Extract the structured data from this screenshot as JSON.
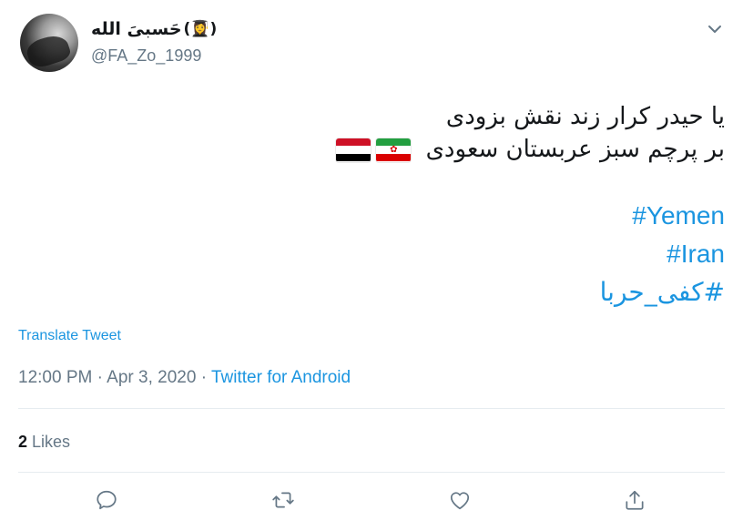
{
  "user": {
    "display_name": "حَسبیَ الله",
    "name_emoji": "(👩‍🎓)",
    "handle": "@FA_Zo_1999"
  },
  "tweet": {
    "line1": "یا حیدر کرار زند نقش بزودی",
    "line2": "بر پرچم سبز عربستان سعودی",
    "hashtags": [
      "#Yemen",
      "#Iran",
      "#کفی_حربا"
    ],
    "flag_colors": {
      "yemen": [
        "#ce1126",
        "#ffffff",
        "#000000"
      ],
      "iran": [
        "#239f40",
        "#ffffff",
        "#da0000"
      ]
    }
  },
  "translate_label": "Translate Tweet",
  "meta": {
    "time": "12:00 PM",
    "date": "Apr 3, 2020",
    "source": "Twitter for Android"
  },
  "stats": {
    "likes_count": "2",
    "likes_label": "Likes"
  },
  "icons": [
    "chevron-down-icon",
    "reply-icon",
    "retweet-icon",
    "like-icon",
    "share-icon"
  ],
  "colors": {
    "link": "#1b95e0",
    "muted": "#657786",
    "divider": "#e6ecf0"
  }
}
